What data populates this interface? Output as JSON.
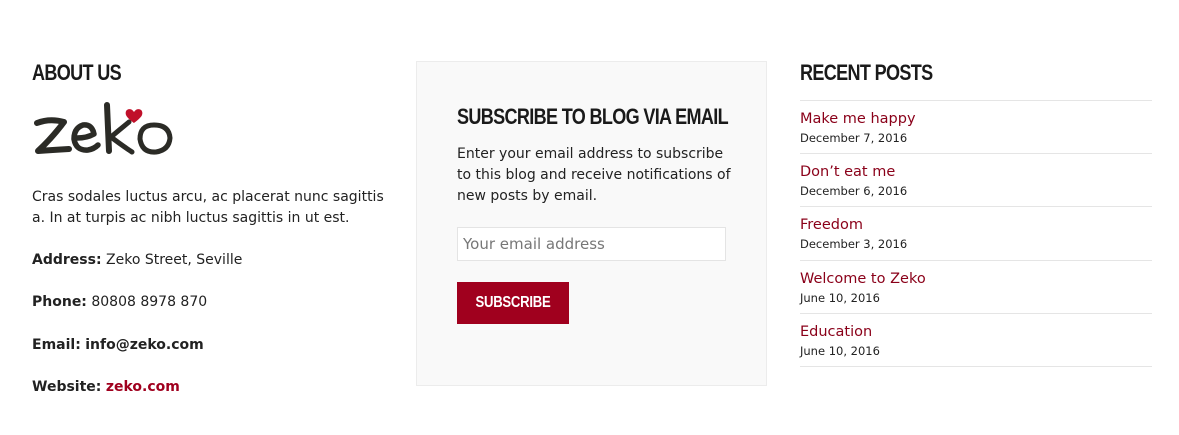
{
  "about": {
    "heading": "About Us",
    "logo_text": "zeko",
    "description": "Cras sodales luctus arcu, ac placerat nunc sagittis a. In at turpis ac nibh luctus sagittis in ut est.",
    "address_label": "Address:",
    "address_value": "Zeko Street, Seville",
    "phone_label": "Phone:",
    "phone_value": "80808 8978 870",
    "email_label": "Email:",
    "email_value": "info@zeko.com",
    "website_label": "Website:",
    "website_value": "zeko.com"
  },
  "subscribe": {
    "heading": "Subscribe to Blog via Email",
    "text": "Enter your email address to subscribe to this blog and receive notifications of new posts by email.",
    "email_placeholder": "Your email address",
    "button_label": "Subscribe"
  },
  "recent": {
    "heading": "Recent Posts",
    "posts": [
      {
        "title": "Make me happy",
        "date": "December 7, 2016"
      },
      {
        "title": "Don’t eat me",
        "date": "December 6, 2016"
      },
      {
        "title": "Freedom",
        "date": "December 3, 2016"
      },
      {
        "title": "Welcome to Zeko",
        "date": "June 10, 2016"
      },
      {
        "title": "Education",
        "date": "June 10, 2016"
      }
    ]
  },
  "colors": {
    "accent": "#a0001e",
    "link": "#8a0019",
    "heart": "#c0102a",
    "text": "#222222",
    "box_bg": "#f9f9f9"
  }
}
